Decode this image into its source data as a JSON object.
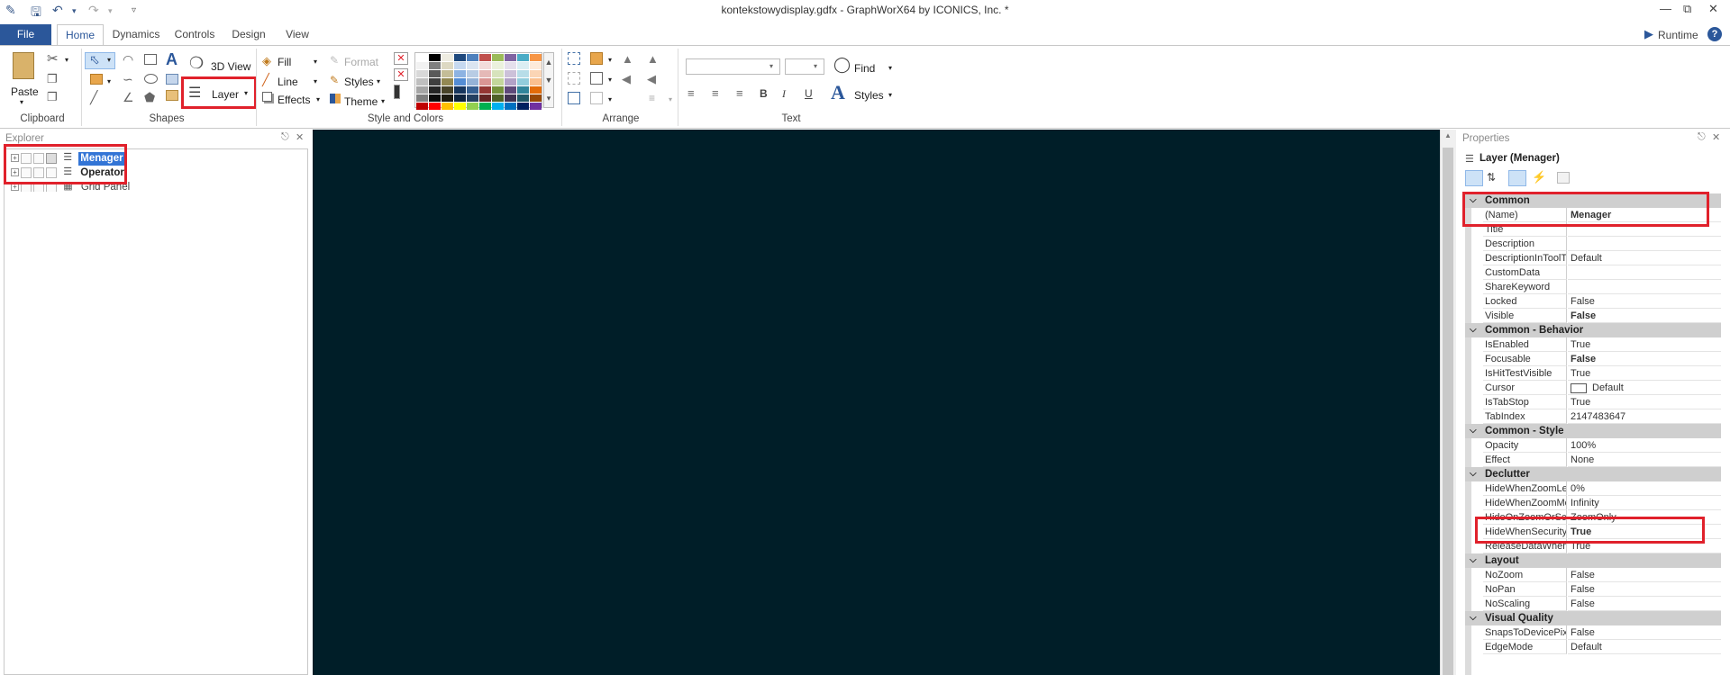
{
  "window": {
    "title": "kontekstowydisplay.gdfx - GraphWorX64 by ICONICS, Inc. *"
  },
  "tabs": [
    {
      "label": "File"
    },
    {
      "label": "Home"
    },
    {
      "label": "Dynamics"
    },
    {
      "label": "Controls"
    },
    {
      "label": "Design"
    },
    {
      "label": "View"
    }
  ],
  "runtime_label": "Runtime",
  "ribbon": {
    "clipboard": {
      "paste": "Paste",
      "group": "Clipboard"
    },
    "shapes": {
      "view3d": "3D View",
      "layer": "Layer",
      "group": "Shapes"
    },
    "style": {
      "fill": "Fill",
      "line": "Line",
      "effects": "Effects",
      "format": "Format",
      "styles": "Styles",
      "theme": "Theme",
      "group": "Style and Colors"
    },
    "arrange": {
      "group": "Arrange"
    },
    "text": {
      "find": "Find",
      "styles": "Styles",
      "bold": "B",
      "italic": "I",
      "underline": "U",
      "group": "Text"
    }
  },
  "palette": {
    "rows": [
      [
        "#ffffff",
        "#000000",
        "#eeece1",
        "#1f497d",
        "#4f81bd",
        "#c0504d",
        "#9bbb59",
        "#8064a2",
        "#4bacc6",
        "#f79646"
      ],
      [
        "#f2f2f2",
        "#7f7f7f",
        "#ddd9c3",
        "#c6d9f0",
        "#dbe5f1",
        "#f2dcdb",
        "#ebf1dd",
        "#e5e0ec",
        "#dbeef3",
        "#fdeada"
      ],
      [
        "#d8d8d8",
        "#595959",
        "#c4bd97",
        "#8db3e2",
        "#b8cce4",
        "#e5b9b7",
        "#d7e3bc",
        "#ccc1d9",
        "#b7dde8",
        "#fbd5b5"
      ],
      [
        "#bfbfbf",
        "#3f3f3f",
        "#938953",
        "#548dd4",
        "#95b3d7",
        "#d99694",
        "#c3d69b",
        "#b2a2c7",
        "#92cddc",
        "#fac08f"
      ],
      [
        "#a5a5a5",
        "#262626",
        "#494429",
        "#17365d",
        "#366092",
        "#953734",
        "#76923c",
        "#5f497a",
        "#31859b",
        "#e36c09"
      ],
      [
        "#7f7f7f",
        "#0c0c0c",
        "#1d1b10",
        "#0f243e",
        "#244061",
        "#632423",
        "#4f6128",
        "#3f3151",
        "#205867",
        "#974806"
      ],
      [
        "#c00000",
        "#ff0000",
        "#ffc000",
        "#ffff00",
        "#92d050",
        "#00b050",
        "#00b0f0",
        "#0070c0",
        "#002060",
        "#7030a0"
      ]
    ]
  },
  "explorer": {
    "title": "Explorer",
    "items": [
      {
        "label": "Menager",
        "selected": true
      },
      {
        "label": "Operator",
        "selected": false
      },
      {
        "label": "Grid Panel",
        "selected": false
      }
    ]
  },
  "properties": {
    "title": "Properties",
    "object": "Layer (Menager)",
    "categories": [
      {
        "name": "Common",
        "rows": [
          {
            "name": "(Name)",
            "value": "Menager",
            "bold": true
          },
          {
            "name": "Title",
            "value": ""
          },
          {
            "name": "Description",
            "value": ""
          },
          {
            "name": "DescriptionInToolTip",
            "value": "Default"
          },
          {
            "name": "CustomData",
            "value": ""
          },
          {
            "name": "ShareKeyword",
            "value": ""
          },
          {
            "name": "Locked",
            "value": "False"
          },
          {
            "name": "Visible",
            "value": "False",
            "bold": true
          }
        ]
      },
      {
        "name": "Common - Behavior",
        "rows": [
          {
            "name": "IsEnabled",
            "value": "True"
          },
          {
            "name": "Focusable",
            "value": "False",
            "bold": true
          },
          {
            "name": "IsHitTestVisible",
            "value": "True"
          },
          {
            "name": "Cursor",
            "value": "Default"
          },
          {
            "name": "IsTabStop",
            "value": "True"
          },
          {
            "name": "TabIndex",
            "value": "2147483647"
          }
        ]
      },
      {
        "name": "Common - Style",
        "rows": [
          {
            "name": "Opacity",
            "value": "100%"
          },
          {
            "name": "Effect",
            "value": "None"
          }
        ]
      },
      {
        "name": "Declutter",
        "rows": [
          {
            "name": "HideWhenZoomLessT",
            "value": "0%"
          },
          {
            "name": "HideWhenZoomMoreT",
            "value": "Infinity"
          },
          {
            "name": "HideOnZoomOrScale",
            "value": "ZoomOnly"
          },
          {
            "name": "HideWhenSecurityDen",
            "value": "True",
            "bold": true
          },
          {
            "name": "ReleaseDataWhenHid",
            "value": "True"
          }
        ]
      },
      {
        "name": "Layout",
        "rows": [
          {
            "name": "NoZoom",
            "value": "False"
          },
          {
            "name": "NoPan",
            "value": "False"
          },
          {
            "name": "NoScaling",
            "value": "False"
          }
        ]
      },
      {
        "name": "Visual Quality",
        "rows": [
          {
            "name": "SnapsToDevicePixels",
            "value": "False"
          },
          {
            "name": "EdgeMode",
            "value": "Default"
          }
        ]
      }
    ]
  },
  "colors": {
    "accent": "#2b579a",
    "canvas": "#001e28",
    "highlight": "#e0212b",
    "selection": "#3375d6"
  }
}
